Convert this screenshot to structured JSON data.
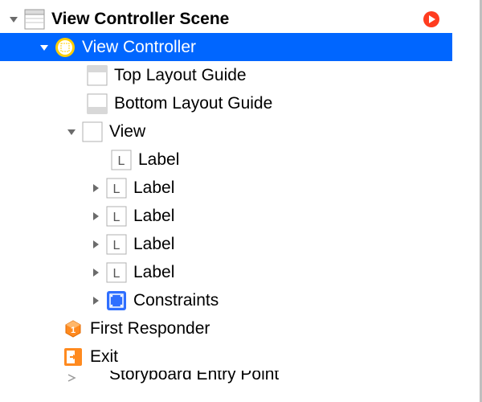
{
  "scene": {
    "title": "View Controller Scene",
    "goto_icon": "arrow-right-circle"
  },
  "tree": {
    "view_controller": "View Controller",
    "top_layout_guide": "Top Layout Guide",
    "bottom_layout_guide": "Bottom Layout Guide",
    "view": "View",
    "labels": [
      "Label",
      "Label",
      "Label",
      "Label",
      "Label"
    ],
    "constraints": "Constraints",
    "first_responder": "First Responder",
    "exit": "Exit",
    "storyboard_entry_point": "Storyboard Entry Point"
  }
}
